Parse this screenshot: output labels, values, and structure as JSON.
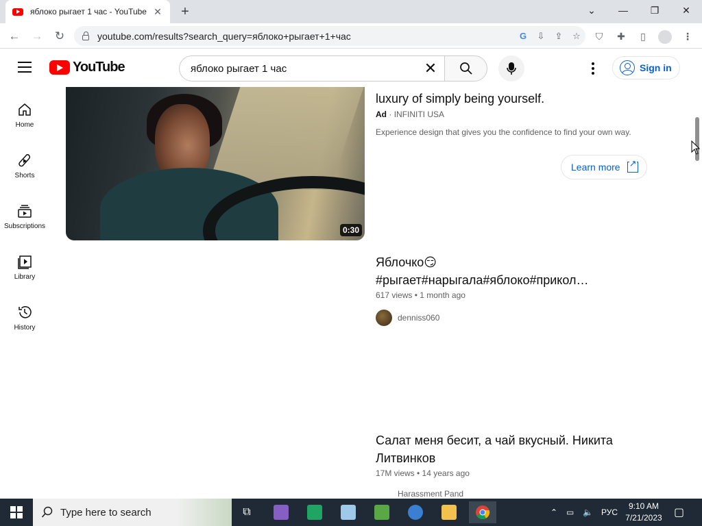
{
  "browser": {
    "tab_title": "яблоко рыгает 1 час - YouTube",
    "url": "youtube.com/results?search_query=яблоко+рыгает+1+час"
  },
  "youtube": {
    "logo_text": "YouTube",
    "search_query": "яблоко рыгает 1 час",
    "sign_in": "Sign in"
  },
  "sidebar": {
    "items": [
      {
        "label": "Home",
        "icon": "home-icon"
      },
      {
        "label": "Shorts",
        "icon": "shorts-icon"
      },
      {
        "label": "Subscriptions",
        "icon": "subscriptions-icon"
      },
      {
        "label": "Library",
        "icon": "library-icon"
      },
      {
        "label": "History",
        "icon": "history-icon"
      }
    ]
  },
  "ad": {
    "title_visible": "luxury of simply being yourself.",
    "badge": "Ad",
    "separator": "·",
    "advertiser": "INFINITI USA",
    "description": "Experience design that gives you the confidence to find your own way.",
    "cta": "Learn more",
    "duration": "0:30"
  },
  "results": [
    {
      "title_line1": "Яблочко😏",
      "title_line2": "#рыгает#нарыгала#яблоко#прикол…",
      "meta": "617 views • 1 month ago",
      "channel": "denniss060"
    },
    {
      "title_line1": "Салат меня бесит, а чай вкусный. Никита",
      "title_line2": "Литвинков",
      "meta": "17M views • 14 years ago",
      "channel": "Harassment Pand"
    }
  ],
  "taskbar": {
    "search_placeholder": "Type here to search",
    "language": "РУС",
    "time": "9:10 AM",
    "date": "7/21/2023"
  },
  "colors": {
    "youtube_red": "#ff0000",
    "link_blue": "#065fd4",
    "taskbar": "#1f2a36"
  }
}
